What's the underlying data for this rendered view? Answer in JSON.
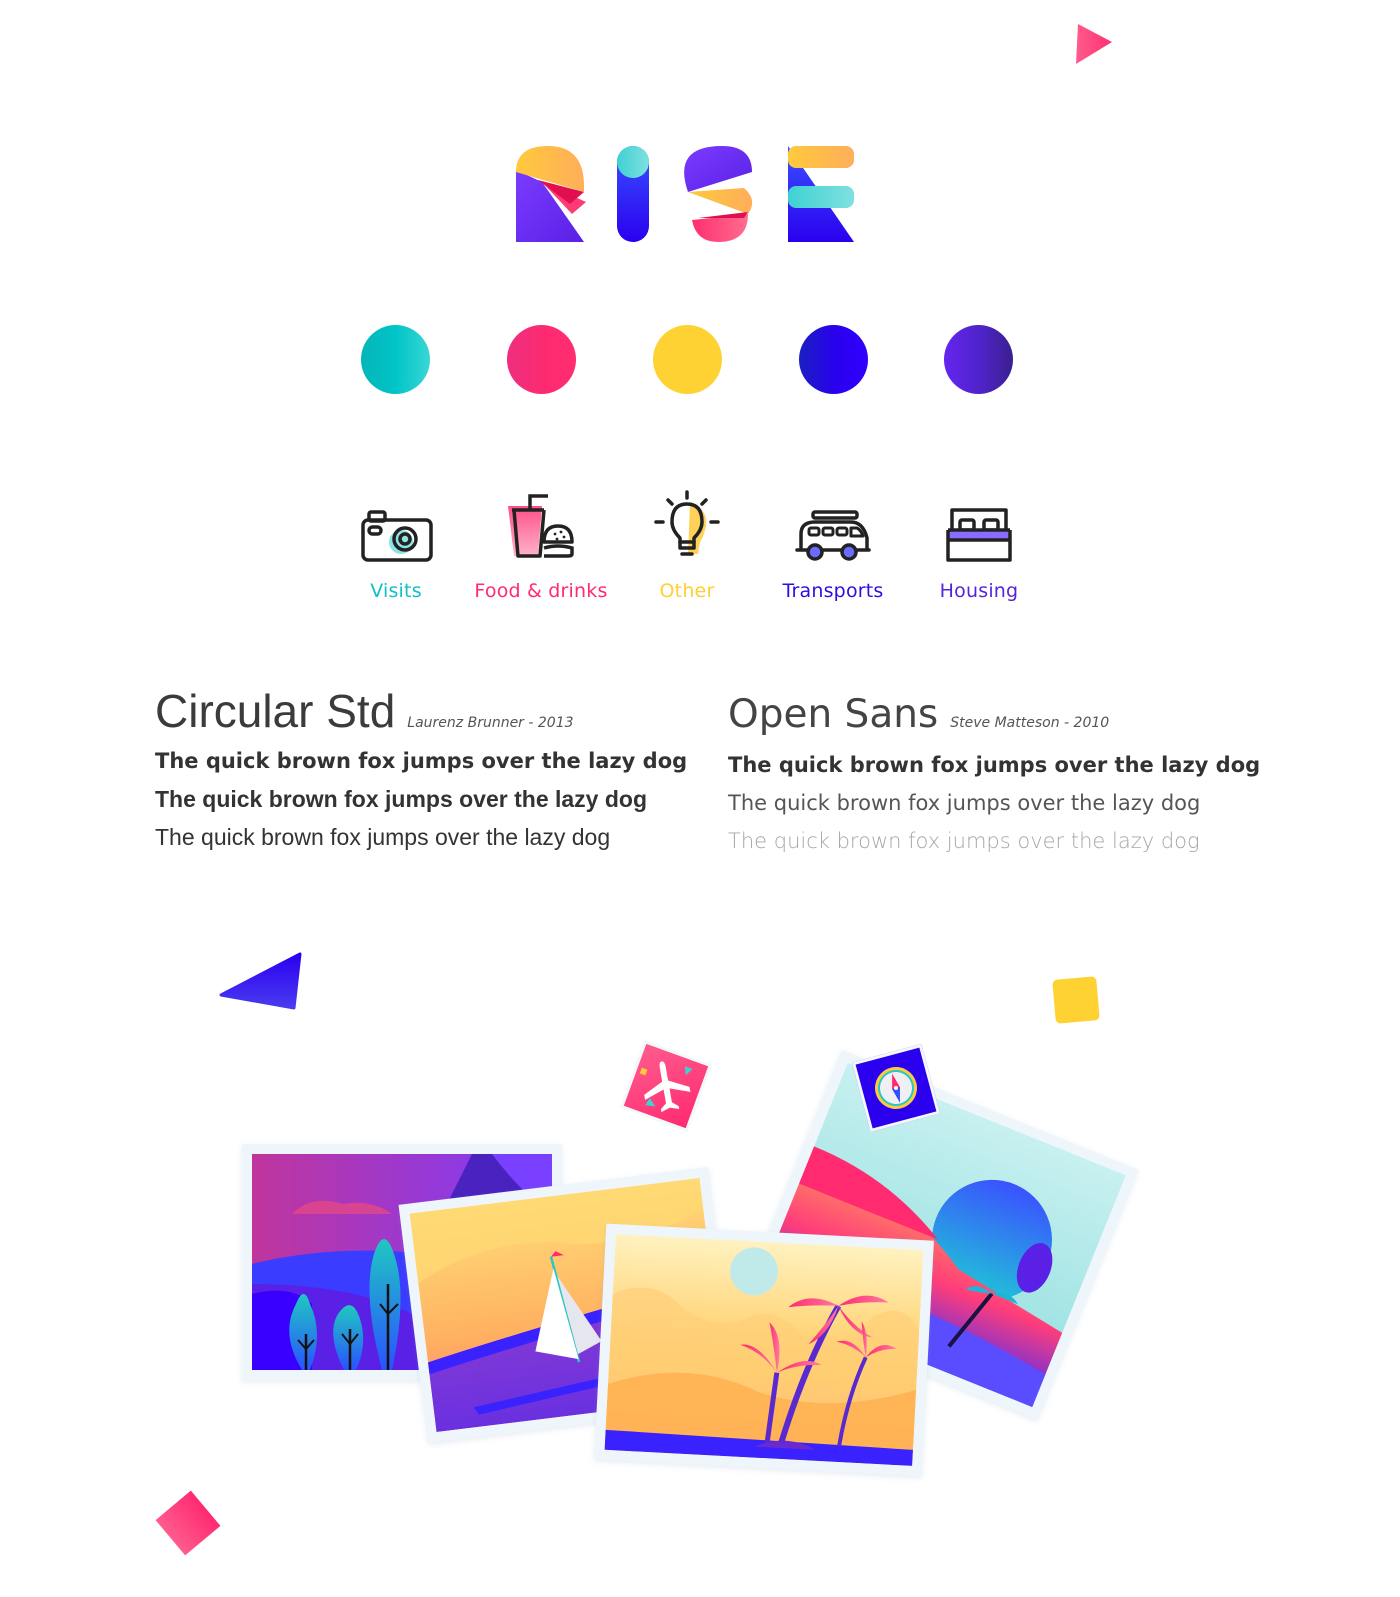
{
  "brand": {
    "name": "RISE",
    "letters": [
      "R",
      "I",
      "S",
      "E"
    ]
  },
  "palette": [
    {
      "name": "teal",
      "hex": "#00c5c7"
    },
    {
      "name": "pink",
      "hex": "#ff2a70"
    },
    {
      "name": "yellow",
      "hex": "#ffd233"
    },
    {
      "name": "blue",
      "hex": "#2a00ef"
    },
    {
      "name": "purple",
      "hex": "#5524d6"
    }
  ],
  "categories": [
    {
      "label": "Visits",
      "icon": "camera-icon",
      "color": "#0fc0c6"
    },
    {
      "label": "Food & drinks",
      "icon": "food-drink-icon",
      "color": "#ff2a70"
    },
    {
      "label": "Other",
      "icon": "lightbulb-icon",
      "color": "#ffcf33"
    },
    {
      "label": "Transports",
      "icon": "van-icon",
      "color": "#2a0fe0"
    },
    {
      "label": "Housing",
      "icon": "bed-icon",
      "color": "#5524d6"
    }
  ],
  "typography": {
    "primary": {
      "name": "Circular Std",
      "meta": "Laurenz Brunner  - 2013",
      "samples": [
        "The quick brown fox jumps over the lazy dog",
        "The quick brown fox jumps over the lazy dog",
        "The quick brown fox jumps over the lazy dog"
      ]
    },
    "secondary": {
      "name": "Open Sans",
      "meta": "Steve Matteson  - 2010",
      "samples": [
        "The quick brown fox jumps over the lazy dog",
        "The quick brown fox jumps over the lazy dog",
        "The quick brown fox jumps over the lazy dog"
      ]
    }
  },
  "illustrations": {
    "photos": [
      "forest-photo",
      "sailboat-photo",
      "palm-desert-photo",
      "beach-sunset-photo"
    ],
    "stamps": [
      "airplane-stamp",
      "compass-stamp"
    ]
  }
}
